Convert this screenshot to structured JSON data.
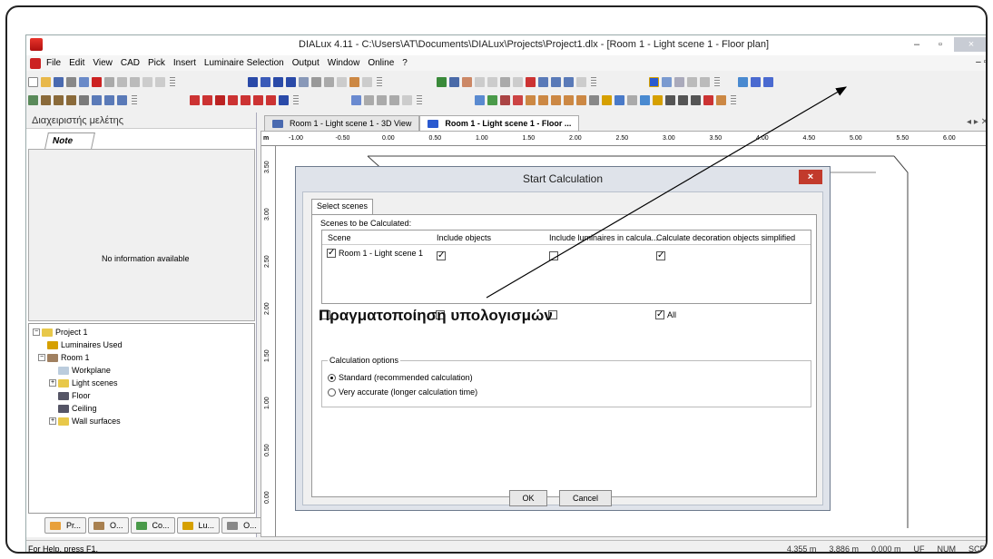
{
  "window": {
    "title": "DIALux 4.11 - C:\\Users\\AT\\Documents\\DIALux\\Projects\\Project1.dlx - [Room 1 - Light scene 1 - Floor plan]",
    "minimize": "–",
    "maximize": "▫",
    "close": "×"
  },
  "menu": [
    "File",
    "Edit",
    "View",
    "CAD",
    "Pick",
    "Insert",
    "Luminaire Selection",
    "Output",
    "Window",
    "Online",
    "?"
  ],
  "left_panel": {
    "title": "Διαχειριστής μελέτης",
    "note_tab": "Note",
    "no_info": "No information available",
    "tree": [
      "Project 1",
      "Luminaires Used",
      "Room 1",
      "Workplane",
      "Light scenes",
      "Floor",
      "Ceiling",
      "Wall surfaces"
    ],
    "bottom_tabs": [
      "Pr...",
      "O...",
      "Co...",
      "Lu...",
      "O..."
    ]
  },
  "doc_tabs": [
    "Room 1 - Light scene 1 - 3D View",
    "Room 1 - Light scene 1 - Floor ..."
  ],
  "ruler": {
    "unit": "m",
    "h_ticks": [
      "-1.00",
      "-0.50",
      "0.00",
      "0.50",
      "1.00",
      "1.50",
      "2.00",
      "2.50",
      "3.00",
      "3.50",
      "4.00",
      "4.50",
      "5.00",
      "5.50",
      "6.00"
    ],
    "v_ticks": [
      "3.50",
      "3.00",
      "2.50",
      "2.00",
      "1.50",
      "1.00",
      "0.50",
      "0.00"
    ]
  },
  "dialog": {
    "title": "Start Calculation",
    "close": "×",
    "tab": "Select scenes",
    "scenes_label": "Scenes to be Calculated:",
    "columns": [
      "Scene",
      "Include objects",
      "Include luminaires in calcula...",
      "Calculate decoration objects simplified"
    ],
    "rows": [
      {
        "scene": "Room 1 - Light scene 1",
        "include_objects": true,
        "include_luminaires": false,
        "decoration_simplified": true
      }
    ],
    "all_label": "All",
    "options_title": "Calculation options",
    "option_standard": "Standard (recommended calculation)",
    "option_accurate": "Very accurate (longer calculation time)",
    "ok": "OK",
    "cancel": "Cancel"
  },
  "annotation": "Πραγματοποίηση υπολογισμών",
  "status": {
    "help": "For Help, press F1.",
    "x": "4.355 m",
    "y": "3.886 m",
    "z": "0.000 m",
    "uf": "UF",
    "num": "NUM",
    "scrl": "SCRL"
  }
}
